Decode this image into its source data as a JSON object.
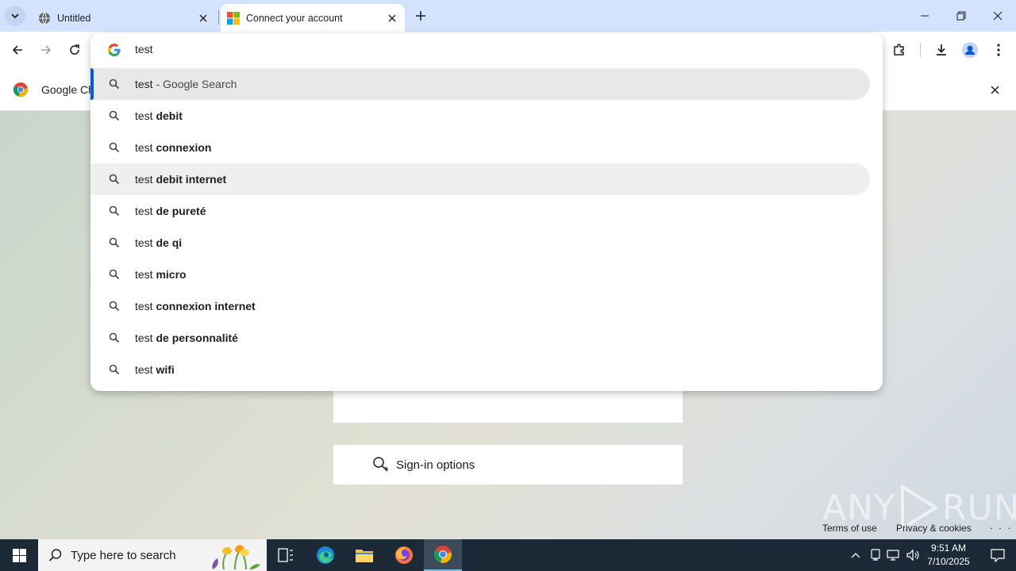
{
  "tabs": [
    {
      "title": "Untitled",
      "active": false
    },
    {
      "title": "Connect your account",
      "active": true
    }
  ],
  "omnibox": {
    "query": "test",
    "suggestions": [
      {
        "prefix": "test",
        "bold": "",
        "suffix": " - Google Search",
        "kind": "search"
      },
      {
        "prefix": "test ",
        "bold": "debit",
        "suffix": ""
      },
      {
        "prefix": "test ",
        "bold": "connexion",
        "suffix": ""
      },
      {
        "prefix": "test ",
        "bold": "debit internet",
        "suffix": ""
      },
      {
        "prefix": "test ",
        "bold": "de pureté",
        "suffix": ""
      },
      {
        "prefix": "test ",
        "bold": "de qi",
        "suffix": ""
      },
      {
        "prefix": "test ",
        "bold": "micro",
        "suffix": ""
      },
      {
        "prefix": "test ",
        "bold": "connexion internet",
        "suffix": ""
      },
      {
        "prefix": "test ",
        "bold": "de personnalité",
        "suffix": ""
      },
      {
        "prefix": "test ",
        "bold": "wifi",
        "suffix": ""
      }
    ]
  },
  "infobar": {
    "text": "Google Ch"
  },
  "page": {
    "signin_options": "Sign-in options",
    "footer": {
      "terms": "Terms of use",
      "privacy": "Privacy & cookies",
      "more": ". . ."
    },
    "watermark": {
      "left": "ANY",
      "right": "RUN"
    }
  },
  "taskbar": {
    "search_placeholder": "Type here to search",
    "time": "9:51 AM",
    "date": "7/10/2025"
  },
  "colors": {
    "tabstrip": "#d3e3fd",
    "accent": "#0b57d0",
    "taskbar": "#1c2a38"
  }
}
